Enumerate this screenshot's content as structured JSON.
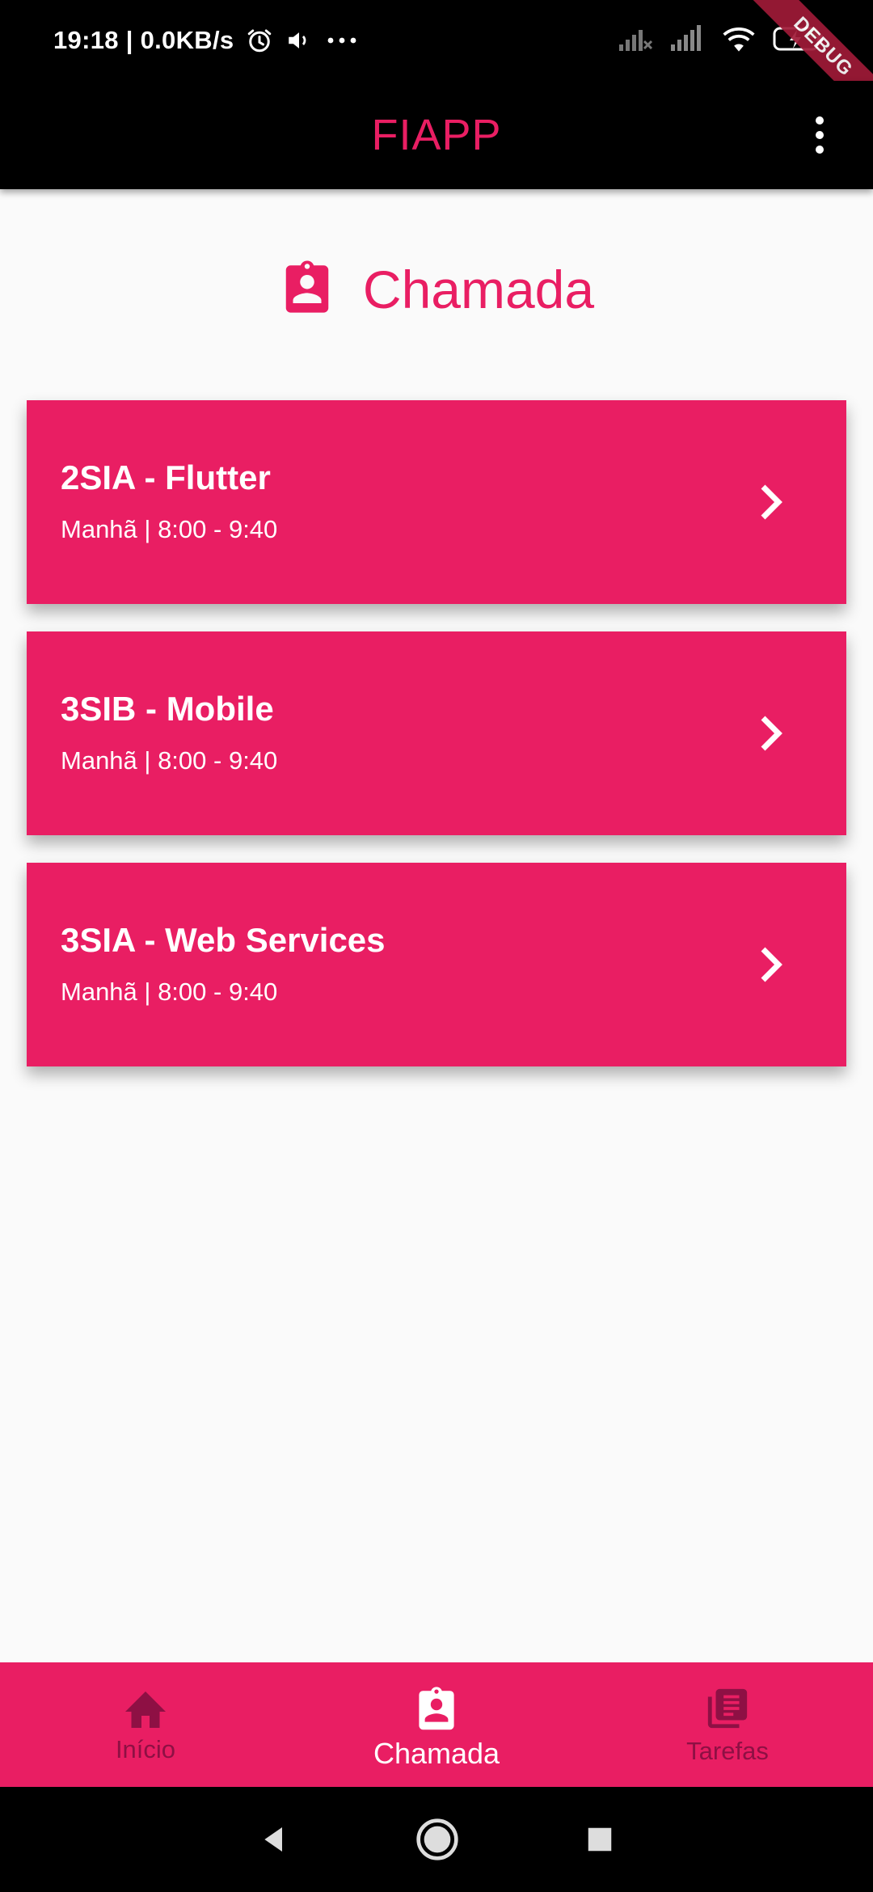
{
  "status_bar": {
    "time_and_speed": "19:18 | 0.0KB/s",
    "icons": [
      "alarm-icon",
      "volume-icon",
      "more-dots-icon",
      "signal-no-sim-icon",
      "signal-icon",
      "wifi-icon",
      "battery-charging-icon"
    ],
    "debug_banner": "DEBUG"
  },
  "app_bar": {
    "title": "FIAPP",
    "title_color": "#e91e63",
    "menu_icon": "more-vert-icon"
  },
  "page": {
    "title": "Chamada",
    "icon": "assignment-ind-icon",
    "accent_color": "#e91e63"
  },
  "classes": [
    {
      "title": "2SIA - Flutter",
      "subtitle": "Manhã  |  8:00 - 9:40"
    },
    {
      "title": "3SIB - Mobile",
      "subtitle": "Manhã  |  8:00 - 9:40"
    },
    {
      "title": "3SIA - Web Services",
      "subtitle": "Manhã  |  8:00 - 9:40"
    }
  ],
  "bottom_nav": {
    "items": [
      {
        "label": "Início",
        "icon": "home-icon",
        "active": false
      },
      {
        "label": "Chamada",
        "icon": "assignment-ind-icon",
        "active": true
      },
      {
        "label": "Tarefas",
        "icon": "library-books-icon",
        "active": false
      }
    ],
    "active_color": "#ffffff",
    "inactive_color": "#8e1044"
  },
  "system_nav": {
    "icons": [
      "back-icon",
      "home-circle-icon",
      "recents-icon"
    ]
  }
}
